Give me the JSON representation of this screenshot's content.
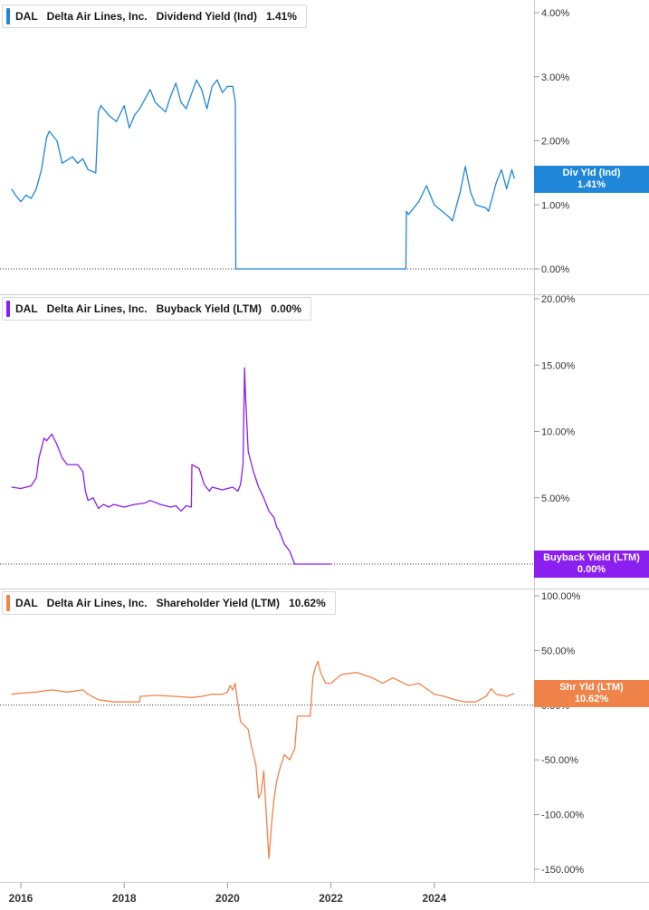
{
  "legends": [
    {
      "ticker": "DAL",
      "company": "Delta Air Lines, Inc.",
      "metric": "Dividend Yield (Ind)",
      "value": "1.41%",
      "color": "#1f86d8"
    },
    {
      "ticker": "DAL",
      "company": "Delta Air Lines, Inc.",
      "metric": "Buyback Yield (LTM)",
      "value": "0.00%",
      "color": "#8a1ff0"
    },
    {
      "ticker": "DAL",
      "company": "Delta Air Lines, Inc.",
      "metric": "Shareholder Yield (LTM)",
      "value": "10.62%",
      "color": "#f0834a"
    }
  ],
  "tags": [
    {
      "label": "Div Yld (Ind)",
      "value": "1.41%",
      "color": "#1f86d8"
    },
    {
      "label": "Buyback Yield (LTM)",
      "value": "0.00%",
      "color": "#8a1ff0"
    },
    {
      "label": "Shr Yld (LTM)",
      "value": "10.62%",
      "color": "#f0834a"
    }
  ],
  "chart_data": [
    {
      "type": "line",
      "series": [
        {
          "name": "Dividend Yield (Ind)",
          "color": "#1f86d8",
          "x": [
            2015.82,
            2015.9,
            2016.0,
            2016.1,
            2016.2,
            2016.3,
            2016.4,
            2016.5,
            2016.55,
            2016.7,
            2016.8,
            2016.9,
            2017.0,
            2017.1,
            2017.2,
            2017.3,
            2017.45,
            2017.5,
            2017.55,
            2017.7,
            2017.85,
            2018.0,
            2018.1,
            2018.2,
            2018.3,
            2018.5,
            2018.6,
            2018.8,
            2018.9,
            2019.0,
            2019.1,
            2019.2,
            2019.4,
            2019.5,
            2019.6,
            2019.7,
            2019.8,
            2019.9,
            2020.0,
            2020.1,
            2020.15,
            2020.16,
            2020.3,
            2020.5,
            2020.7,
            2021.0,
            2021.5,
            2022.0,
            2022.5,
            2023.0,
            2023.3,
            2023.45,
            2023.46,
            2023.5,
            2023.6,
            2023.7,
            2023.85,
            2024.0,
            2024.15,
            2024.3,
            2024.35,
            2024.5,
            2024.6,
            2024.7,
            2024.8,
            2025.0,
            2025.05,
            2025.2,
            2025.3,
            2025.4,
            2025.5,
            2025.55
          ],
          "y": [
            1.25,
            1.15,
            1.05,
            1.15,
            1.1,
            1.25,
            1.55,
            2.05,
            2.15,
            2.0,
            1.65,
            1.7,
            1.75,
            1.65,
            1.72,
            1.55,
            1.5,
            2.45,
            2.55,
            2.4,
            2.3,
            2.55,
            2.2,
            2.4,
            2.5,
            2.8,
            2.6,
            2.45,
            2.7,
            2.9,
            2.6,
            2.5,
            2.95,
            2.8,
            2.5,
            2.85,
            2.95,
            2.75,
            2.85,
            2.85,
            2.6,
            0.0,
            0.0,
            0.0,
            0.0,
            0.0,
            0.0,
            0.0,
            0.0,
            0.0,
            0.0,
            0.0,
            0.9,
            0.85,
            0.95,
            1.05,
            1.3,
            1.0,
            0.9,
            0.8,
            0.75,
            1.2,
            1.6,
            1.2,
            1.0,
            0.95,
            0.9,
            1.35,
            1.55,
            1.25,
            1.55,
            1.41
          ]
        }
      ],
      "xlim": [
        2015.8,
        2025.65
      ],
      "ylim": [
        0,
        4
      ],
      "yticks": [
        "4.00%",
        "3.00%",
        "2.00%",
        "1.00%",
        "0.00%"
      ],
      "ytick_values": [
        4,
        3,
        2,
        1,
        0
      ]
    },
    {
      "type": "line",
      "series": [
        {
          "name": "Buyback Yield (LTM)",
          "color": "#8a1ff0",
          "x": [
            2015.82,
            2016.0,
            2016.2,
            2016.3,
            2016.35,
            2016.45,
            2016.5,
            2016.6,
            2016.7,
            2016.8,
            2016.9,
            2017.1,
            2017.2,
            2017.25,
            2017.3,
            2017.4,
            2017.5,
            2017.6,
            2017.7,
            2017.8,
            2018.0,
            2018.2,
            2018.4,
            2018.5,
            2018.7,
            2018.9,
            2019.0,
            2019.1,
            2019.2,
            2019.3,
            2019.31,
            2019.45,
            2019.55,
            2019.65,
            2019.7,
            2019.9,
            2020.1,
            2020.2,
            2020.25,
            2020.3,
            2020.33,
            2020.35,
            2020.4,
            2020.5,
            2020.6,
            2020.7,
            2020.8,
            2020.9,
            2020.95,
            2021.0,
            2021.1,
            2021.2,
            2021.3,
            2021.5,
            2021.8,
            2022.0
          ],
          "y": [
            5.8,
            5.7,
            5.9,
            6.5,
            8.0,
            9.5,
            9.3,
            9.8,
            9.0,
            8.0,
            7.5,
            7.5,
            7.0,
            5.5,
            4.8,
            5.0,
            4.2,
            4.5,
            4.3,
            4.5,
            4.3,
            4.5,
            4.6,
            4.8,
            4.5,
            4.3,
            4.4,
            4.0,
            4.4,
            4.3,
            7.5,
            7.2,
            6.0,
            5.5,
            5.8,
            5.6,
            5.8,
            5.5,
            6.0,
            7.5,
            14.8,
            12.5,
            8.5,
            7.0,
            5.8,
            5.0,
            4.0,
            3.5,
            2.8,
            2.5,
            1.5,
            1.0,
            0.0,
            0.0,
            0.0,
            0.0
          ]
        }
      ],
      "xlim": [
        2015.8,
        2025.65
      ],
      "ylim": [
        0,
        20
      ],
      "yticks": [
        "20.00%",
        "15.00%",
        "10.00%",
        "5.00%"
      ],
      "ytick_values": [
        20,
        15,
        10,
        5
      ]
    },
    {
      "type": "line",
      "series": [
        {
          "name": "Shareholder Yield (LTM)",
          "color": "#f0834a",
          "x": [
            2015.82,
            2016.0,
            2016.3,
            2016.6,
            2016.9,
            2017.2,
            2017.3,
            2017.5,
            2017.8,
            2018.1,
            2018.3,
            2018.31,
            2018.6,
            2019.0,
            2019.3,
            2019.5,
            2019.7,
            2019.9,
            2020.0,
            2020.05,
            2020.1,
            2020.15,
            2020.16,
            2020.25,
            2020.4,
            2020.45,
            2020.55,
            2020.6,
            2020.65,
            2020.7,
            2020.75,
            2020.8,
            2020.85,
            2020.9,
            2020.95,
            2021.0,
            2021.1,
            2021.2,
            2021.3,
            2021.35,
            2021.45,
            2021.6,
            2021.65,
            2021.7,
            2021.75,
            2021.8,
            2021.9,
            2022.0,
            2022.2,
            2022.5,
            2022.8,
            2023.0,
            2023.2,
            2023.5,
            2023.7,
            2024.0,
            2024.2,
            2024.4,
            2024.6,
            2024.8,
            2025.0,
            2025.1,
            2025.2,
            2025.4,
            2025.55
          ],
          "y": [
            10,
            11,
            12,
            14,
            12,
            14,
            10,
            5,
            3,
            3,
            3,
            8,
            9,
            8,
            7,
            8,
            10,
            10,
            12,
            18,
            14,
            20,
            15,
            -15,
            -22,
            -35,
            -55,
            -85,
            -80,
            -60,
            -100,
            -140,
            -110,
            -85,
            -70,
            -60,
            -45,
            -50,
            -40,
            -10,
            -10,
            -10,
            25,
            35,
            40,
            30,
            20,
            20,
            28,
            30,
            25,
            20,
            25,
            18,
            20,
            10,
            8,
            5,
            3,
            3,
            8,
            15,
            10,
            8,
            10.62
          ]
        }
      ],
      "xlim": [
        2015.8,
        2025.65
      ],
      "ylim": [
        -150,
        100
      ],
      "yticks": [
        "100.00%",
        "50.00%",
        "0.00%",
        "-50.00%",
        "-100.00%",
        "-150.00%"
      ],
      "ytick_values": [
        100,
        50,
        0,
        -50,
        -100,
        -150
      ]
    }
  ],
  "xaxis": {
    "ticks": [
      "2016",
      "2018",
      "2020",
      "2022",
      "2024"
    ],
    "tick_values": [
      2016,
      2018,
      2020,
      2022,
      2024
    ]
  }
}
